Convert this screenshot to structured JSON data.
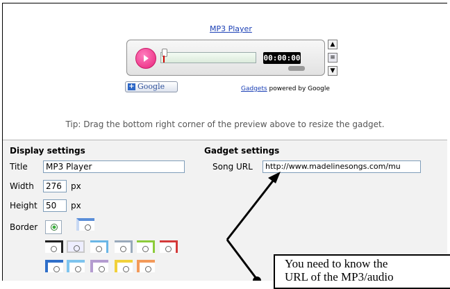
{
  "preview": {
    "gadget_title": "MP3 Player",
    "player": {
      "time": "00:00:00"
    },
    "google_button": {
      "plus": "+",
      "label": "Google"
    },
    "powered": {
      "link": "Gadgets",
      "text": " powered by Google"
    },
    "tip": "Tip: Drag the bottom right corner of the preview above to resize the gadget."
  },
  "display_settings": {
    "heading": "Display settings",
    "title_label": "Title",
    "title_value": "MP3 Player",
    "width_label": "Width",
    "width_value": "276",
    "width_unit": "px",
    "height_label": "Height",
    "height_value": "50",
    "height_unit": "px",
    "border_label": "Border"
  },
  "gadget_settings": {
    "heading": "Gadget settings",
    "song_url_label": "Song URL",
    "song_url_value": "http://www.madelinesongs.com/mu"
  },
  "callout": {
    "line1": "You need to know the",
    "line2": "URL of the MP3/audio"
  },
  "colors": {
    "link": "#1a3fb5",
    "play": "#e8227a",
    "settings_bg": "#f2f2f2"
  }
}
